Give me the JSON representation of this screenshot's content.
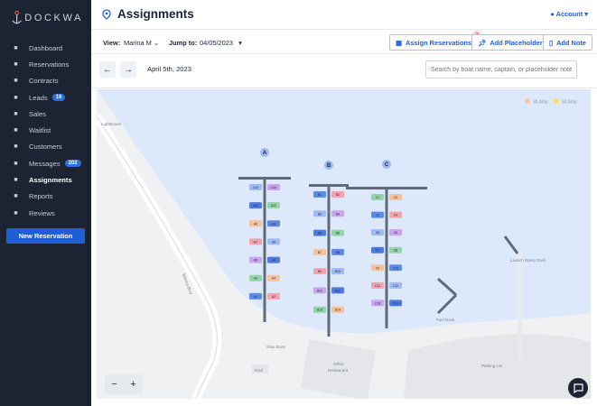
{
  "brand": {
    "name": "DOCKWA"
  },
  "sidebar": {
    "items": [
      {
        "label": "Dashboard",
        "icon": "dashboard-icon",
        "badge": null,
        "active": false
      },
      {
        "label": "Reservations",
        "icon": "calendar-icon",
        "badge": null,
        "active": false
      },
      {
        "label": "Contracts",
        "icon": "contract-icon",
        "badge": null,
        "active": false
      },
      {
        "label": "Leads",
        "icon": "inbox-icon",
        "badge": "16",
        "active": false
      },
      {
        "label": "Sales",
        "icon": "cart-icon",
        "badge": null,
        "active": false
      },
      {
        "label": "Waitlist",
        "icon": "list-icon",
        "badge": null,
        "active": false
      },
      {
        "label": "Customers",
        "icon": "people-icon",
        "badge": null,
        "active": false
      },
      {
        "label": "Messages",
        "icon": "envelope-icon",
        "badge": "202",
        "active": false
      },
      {
        "label": "Assignments",
        "icon": "pin-icon",
        "badge": null,
        "active": true
      },
      {
        "label": "Reports",
        "icon": "chart-icon",
        "badge": null,
        "active": false
      },
      {
        "label": "Reviews",
        "icon": "star-icon",
        "badge": null,
        "active": false
      }
    ],
    "new_button": "New Reservation"
  },
  "header": {
    "title": "Assignments",
    "account_label": "Account"
  },
  "toolbar": {
    "view_label": "View:",
    "view_value": "Marina M",
    "jump_label": "Jump to:",
    "jump_value": "04/05/2023",
    "assign_button": "Assign Reservations",
    "assign_badge": "3",
    "placeholder_button": "Add Placeholder",
    "note_button": "Add Note"
  },
  "datebar": {
    "date": "April 5th, 2023",
    "search_placeholder": "Search by boat name, captain, or placeholder note"
  },
  "map": {
    "legend": [
      {
        "label": "30 Amp",
        "color": "#f2c9a9"
      },
      {
        "label": "50 Amp",
        "color": "#f5e06e"
      }
    ],
    "docks": [
      {
        "label": "A"
      },
      {
        "label": "B"
      },
      {
        "label": "C"
      }
    ],
    "places": {
      "lighthouse": "Lighthouse",
      "ship_store": "Ship Store",
      "office": "Office",
      "restaurant": "Restaurant",
      "pool": "Pool",
      "fuel_dock": "Fuel Dock",
      "launch_ramp": "Launch Ramp Dock",
      "parking": "Parking Lot",
      "road": "Marina Blvd"
    },
    "slip_labels": {
      "A": [
        "A14",
        "A16",
        "A11",
        "A13",
        "A9",
        "A10",
        "A7",
        "A8",
        "A5",
        "A6",
        "A3",
        "A4",
        "A1",
        "A2"
      ],
      "B": [
        "B1",
        "B2",
        "B3",
        "B4",
        "B5",
        "B6",
        "B7",
        "B8",
        "B9",
        "B10",
        "B11",
        "B12",
        "B13",
        "B14"
      ],
      "C": [
        "C1",
        "C2",
        "C3",
        "C4",
        "C5",
        "C6",
        "C7",
        "C8",
        "C9",
        "C10",
        "C11",
        "C12",
        "C13",
        "C14"
      ]
    },
    "zoom_out": "−",
    "zoom_in": "+"
  },
  "colors": {
    "accent": "#1f5fd6",
    "sidebar": "#1c2433",
    "water": "#dde8fb"
  }
}
